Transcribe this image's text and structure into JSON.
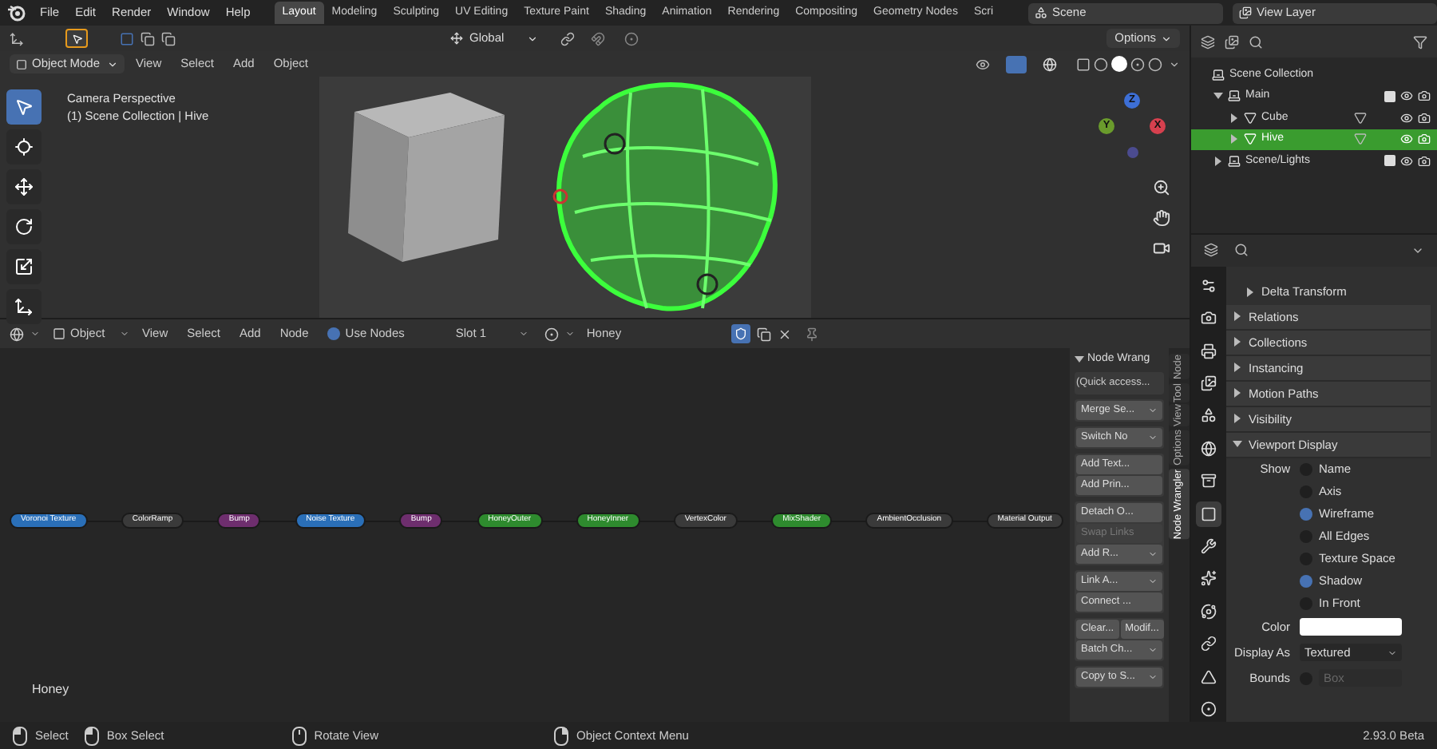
{
  "topbar": {
    "menus": [
      "File",
      "Edit",
      "Render",
      "Window",
      "Help"
    ],
    "workspaces": [
      {
        "label": "Layout",
        "selected": true
      },
      {
        "label": "Modeling",
        "selected": false
      },
      {
        "label": "Sculpting",
        "selected": false
      },
      {
        "label": "UV Editing",
        "selected": false
      },
      {
        "label": "Texture Paint",
        "selected": false
      },
      {
        "label": "Shading",
        "selected": false
      },
      {
        "label": "Animation",
        "selected": false
      },
      {
        "label": "Rendering",
        "selected": false
      },
      {
        "label": "Compositing",
        "selected": false
      },
      {
        "label": "Geometry Nodes",
        "selected": false
      },
      {
        "label": "Scri",
        "selected": false
      }
    ],
    "scene": "Scene",
    "view_layer": "View Layer"
  },
  "viewport": {
    "transform_orientation": "Global",
    "options": "Options",
    "mode": "Object Mode",
    "menus": [
      "View",
      "Select",
      "Add",
      "Object"
    ],
    "overlay_title": "Camera Perspective",
    "overlay_subtitle": "(1) Scene Collection | Hive",
    "tools": [
      {
        "kind": "select",
        "selected": true
      },
      {
        "kind": "cursor",
        "selected": false
      },
      {
        "kind": "move",
        "selected": false
      },
      {
        "kind": "rotate",
        "selected": false
      },
      {
        "kind": "scale",
        "selected": false
      },
      {
        "kind": "transform",
        "selected": false
      }
    ],
    "axes": [
      {
        "label": "Z",
        "color": "#3d6fd6"
      },
      {
        "label": "Y",
        "color": "#6a9b2c"
      },
      {
        "label": "X",
        "color": "#d6404e"
      }
    ]
  },
  "node_editor": {
    "object_type": "Object",
    "menus": [
      "View",
      "Select",
      "Add",
      "Node"
    ],
    "use_nodes": {
      "label": "Use Nodes",
      "checked": true
    },
    "slot": "Slot 1",
    "material": "Honey",
    "fake_user": true,
    "nodes": [
      {
        "label": "Voronoi Texture",
        "color": "#2a6fb8"
      },
      {
        "label": "ColorRamp",
        "color": "#3a3a3a"
      },
      {
        "label": "Bump",
        "color": "#6e2e6e"
      },
      {
        "label": "Noise Texture",
        "color": "#2a6fb8"
      },
      {
        "label": "Bump",
        "color": "#6e2e6e"
      },
      {
        "label": "HoneyOuter",
        "color": "#2e8b2e"
      },
      {
        "label": "HoneyInner",
        "color": "#2e8b2e"
      },
      {
        "label": "VertexColor",
        "color": "#3a3a3a"
      },
      {
        "label": "MixShader",
        "color": "#2e8b2e"
      },
      {
        "label": "AmbientOcclusion",
        "color": "#3a3a3a"
      },
      {
        "label": "Material Output",
        "color": "#3a3a3a"
      }
    ],
    "tree_label": "Honey",
    "sidebar": {
      "panel_title": "Node Wrang",
      "groups": [
        [
          {
            "kind": "text",
            "label": "(Quick access..."
          }
        ],
        [
          {
            "kind": "dropdown",
            "label": "Merge Se..."
          }
        ],
        [
          {
            "kind": "dropdown",
            "label": "Switch No"
          }
        ],
        [
          {
            "kind": "button",
            "label": "Add Text..."
          },
          {
            "kind": "button",
            "label": "Add Prin..."
          }
        ],
        [
          {
            "kind": "button",
            "label": "Detach O..."
          },
          {
            "kind": "disabled",
            "label": "Swap Links"
          },
          {
            "kind": "dropdown",
            "label": "Add R..."
          }
        ],
        [
          {
            "kind": "dropdown",
            "label": "Link A..."
          },
          {
            "kind": "button",
            "label": "Connect ..."
          }
        ],
        [
          {
            "kind": "pair",
            "labels": [
              "Clear...",
              "Modif..."
            ]
          },
          {
            "kind": "dropdown",
            "label": "Batch Ch..."
          }
        ],
        [
          {
            "kind": "dropdown",
            "label": "Copy to S..."
          }
        ]
      ],
      "tabs": [
        {
          "label": "Node",
          "selected": false
        },
        {
          "label": "Tool",
          "selected": false
        },
        {
          "label": "View",
          "selected": false
        },
        {
          "label": "Options",
          "selected": false
        },
        {
          "label": "Node Wrangler",
          "selected": true
        }
      ]
    }
  },
  "outliner": {
    "tree": [
      {
        "label": "Scene Collection",
        "kind": "scene",
        "selected": false,
        "children": [
          {
            "label": "Main",
            "kind": "collection",
            "selected": false,
            "expanded": true,
            "checked": true,
            "children": [
              {
                "label": "Cube",
                "kind": "object",
                "selected": false,
                "expanded": false
              },
              {
                "label": "Hive",
                "kind": "object",
                "selected": true,
                "expanded": false
              }
            ]
          },
          {
            "label": "Scene/Lights",
            "kind": "collection",
            "selected": false,
            "expanded": false,
            "checked": true
          }
        ]
      }
    ]
  },
  "properties": {
    "tabs": [
      {
        "kind": "tool",
        "selected": false
      },
      {
        "kind": "render",
        "selected": false
      },
      {
        "kind": "output",
        "selected": false
      },
      {
        "kind": "view_layer",
        "selected": false
      },
      {
        "kind": "scene",
        "selected": false
      },
      {
        "kind": "world",
        "selected": false
      },
      {
        "kind": "collection",
        "selected": false
      },
      {
        "kind": "object",
        "selected": true
      },
      {
        "kind": "modifier",
        "selected": false
      },
      {
        "kind": "particles",
        "selected": false
      },
      {
        "kind": "physics",
        "selected": false
      },
      {
        "kind": "constraints",
        "selected": false
      },
      {
        "kind": "data",
        "selected": false
      },
      {
        "kind": "material",
        "selected": false
      }
    ],
    "sections": [
      {
        "label": "Delta Transform",
        "expanded": false,
        "kind": "sub"
      },
      {
        "label": "Relations",
        "expanded": false,
        "kind": "panel"
      },
      {
        "label": "Collections",
        "expanded": false,
        "kind": "panel"
      },
      {
        "label": "Instancing",
        "expanded": false,
        "kind": "panel"
      },
      {
        "label": "Motion Paths",
        "expanded": false,
        "kind": "panel"
      },
      {
        "label": "Visibility",
        "expanded": false,
        "kind": "panel"
      },
      {
        "label": "Viewport Display",
        "expanded": true,
        "kind": "panel"
      }
    ],
    "show_label": "Show",
    "show_options": [
      {
        "label": "Name",
        "checked": false
      },
      {
        "label": "Axis",
        "checked": false
      },
      {
        "label": "Wireframe",
        "checked": true
      },
      {
        "label": "All Edges",
        "checked": false
      },
      {
        "label": "Texture Space",
        "checked": false
      },
      {
        "label": "Shadow",
        "checked": true
      },
      {
        "label": "In Front",
        "checked": false
      }
    ],
    "color_field": {
      "label": "Color"
    },
    "display_as": {
      "label": "Display As",
      "value": "Textured"
    },
    "bounds": {
      "label": "Bounds",
      "checked": false,
      "value": "Box",
      "disabled": true
    }
  },
  "status_bar": {
    "items": [
      {
        "kind": "left",
        "label": "Select"
      },
      {
        "kind": "box",
        "label": "Box Select"
      },
      {
        "kind": "middle",
        "label": "Rotate View"
      },
      {
        "kind": "right",
        "label": "Object Context Menu"
      }
    ],
    "version": "2.93.0 Beta"
  }
}
